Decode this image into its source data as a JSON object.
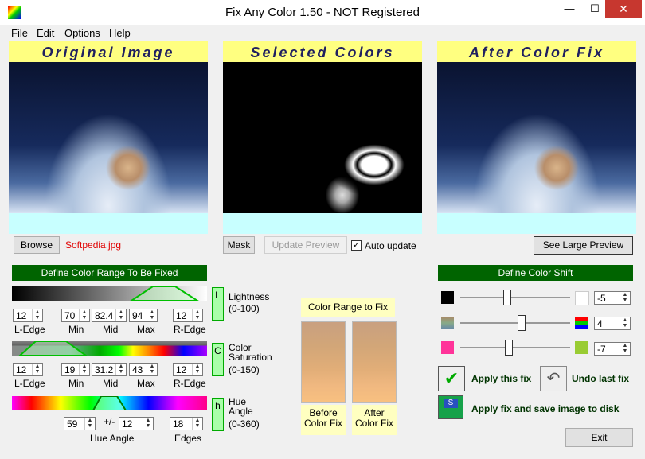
{
  "window": {
    "title": "Fix Any Color 1.50 - NOT Registered",
    "minimize": "—",
    "maximize": "☐",
    "close": "✕"
  },
  "menu": [
    "File",
    "Edit",
    "Options",
    "Help"
  ],
  "panels": {
    "original": "Original Image",
    "selected": "Selected Colors",
    "after": "After Color Fix"
  },
  "toolbar": {
    "browse": "Browse",
    "filename": "Softpedia.jpg",
    "mask": "Mask",
    "update_preview": "Update Preview",
    "auto_update": "Auto update",
    "auto_update_checked": true,
    "see_large": "See Large Preview"
  },
  "range": {
    "header": "Define Color Range To Be Fixed",
    "lightness": {
      "side": "L",
      "label1": "Lightness",
      "label2": "(0-100)",
      "ledge": "12",
      "min": "70",
      "mid": "82.4",
      "max": "94",
      "redge": "12"
    },
    "saturation": {
      "side": "C",
      "label1": "Color",
      "label2": "Saturation",
      "label3": "(0-150)",
      "ledge": "12",
      "min": "19",
      "mid": "31.2",
      "max": "43",
      "redge": "12"
    },
    "hue": {
      "side": "h",
      "label1": "Hue",
      "label2": "Angle",
      "label3": "(0-360)",
      "angle": "59",
      "pm": "+/-",
      "tol": "12",
      "edges": "18"
    },
    "col_labels": {
      "ledge": "L-Edge",
      "min": "Min",
      "mid": "Mid",
      "max": "Max",
      "redge": "R-Edge",
      "hue_angle": "Hue Angle",
      "edges": "Edges"
    }
  },
  "colorbox": {
    "title": "Color Range to Fix",
    "before": "Before Color Fix",
    "after": "After Color Fix"
  },
  "shift": {
    "header": "Define Color Shift",
    "v1": "-5",
    "v2": "4",
    "v3": "-7",
    "apply": "Apply this fix",
    "undo": "Undo last fix",
    "apply_save": "Apply fix and save image to disk",
    "exit": "Exit"
  },
  "colors": {
    "green_dark": "#006400",
    "yellow": "#ffff80",
    "cyan": "#c8ffff"
  }
}
